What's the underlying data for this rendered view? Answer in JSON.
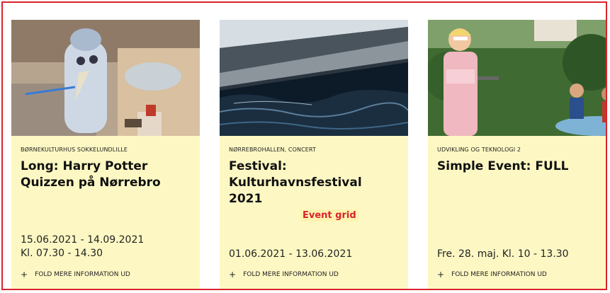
{
  "grid_label": "Event grid",
  "more_label": "FOLD MERE INFORMATION UD",
  "events": [
    {
      "category": "BØRNEKULTURHUS SOKKELUNDLILLE",
      "title": "Long: Harry Potter Quizzen på Nørrebro",
      "date_line1": "15.06.2021 - 14.09.2021",
      "date_line2": "Kl. 07.30 - 14.30",
      "image": "craft-bottle-figure-photo"
    },
    {
      "category": "NØRREBROHALLEN, CONCERT",
      "title": "Festival: Kulturhavnsfestival 2021",
      "date_line1": "01.06.2021 - 13.06.2021",
      "image": "harbour-water-photo"
    },
    {
      "category": "UDVIKLING OG TEKNOLOGI 2",
      "title": "Simple Event: FULL",
      "date_line1": "Fre. 28. maj. Kl. 10 - 13.30",
      "image": "garden-party-photo"
    }
  ],
  "colors": {
    "card_bg": "#fdf8c3",
    "frame_border": "#d9232d",
    "label_text": "#d9232d"
  }
}
